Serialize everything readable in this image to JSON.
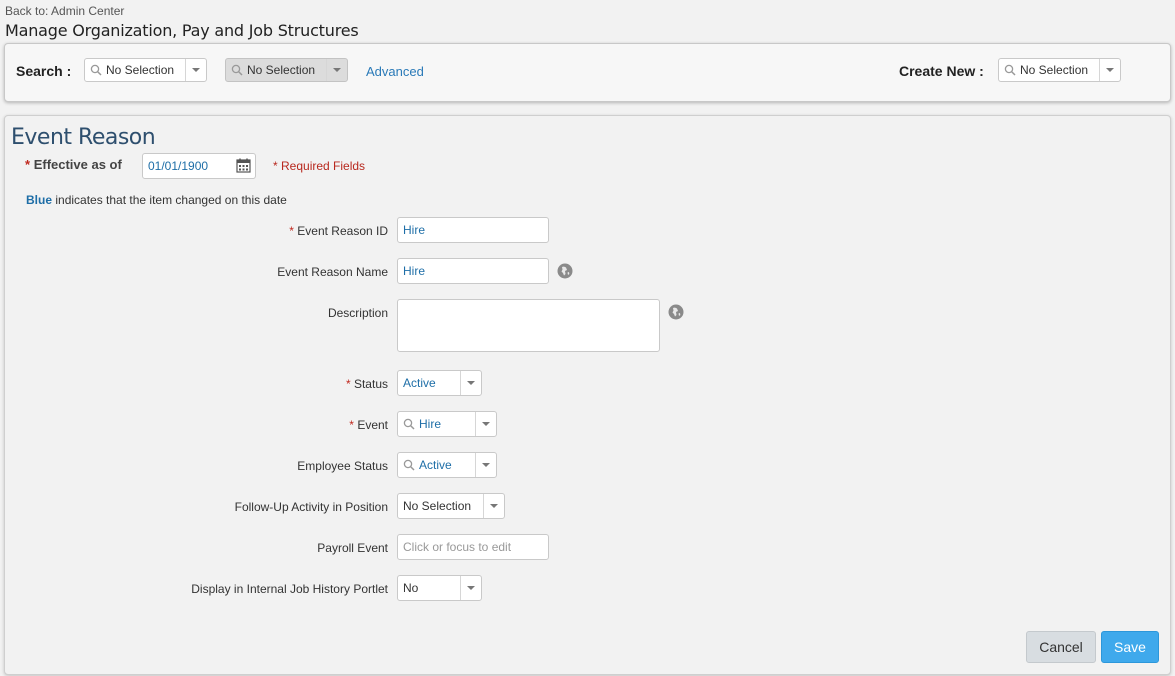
{
  "header": {
    "back_link": "Back to: Admin Center",
    "title": "Manage Organization, Pay and Job Structures"
  },
  "search_bar": {
    "search_label": "Search :",
    "search_type_value": "No Selection",
    "search_item_value": "No Selection",
    "advanced_label": "Advanced",
    "create_new_label": "Create New :",
    "create_new_value": "No Selection"
  },
  "form": {
    "section_title": "Event Reason",
    "effective_label": "Effective as of",
    "effective_date": "01/01/1900",
    "required_star": "*",
    "required_note": "* Required Fields",
    "blue_word": "Blue",
    "blue_note": " indicates that the item changed on this date",
    "fields": {
      "event_reason_id": {
        "label": "Event Reason ID",
        "value": "Hire"
      },
      "event_reason_name": {
        "label": "Event Reason Name",
        "value": "Hire"
      },
      "description": {
        "label": "Description",
        "value": ""
      },
      "status": {
        "label": "Status",
        "value": "Active"
      },
      "event": {
        "label": "Event",
        "value": "Hire"
      },
      "employee_status": {
        "label": "Employee Status",
        "value": "Active"
      },
      "follow_up": {
        "label": "Follow-Up Activity in Position",
        "value": "No Selection"
      },
      "payroll_event": {
        "label": "Payroll Event",
        "placeholder": "Click or focus to edit"
      },
      "display_history": {
        "label": "Display in Internal Job History Portlet",
        "value": "No"
      }
    }
  },
  "buttons": {
    "cancel": "Cancel",
    "save": "Save"
  },
  "icons": {
    "search": "magnifier-icon",
    "dropdown": "chevron-down-icon",
    "calendar": "calendar-icon",
    "translate": "globe-icon"
  },
  "colors": {
    "accent_blue": "#1e6ea7",
    "required_red": "#c0281e",
    "save_button": "#3fa9ec"
  }
}
